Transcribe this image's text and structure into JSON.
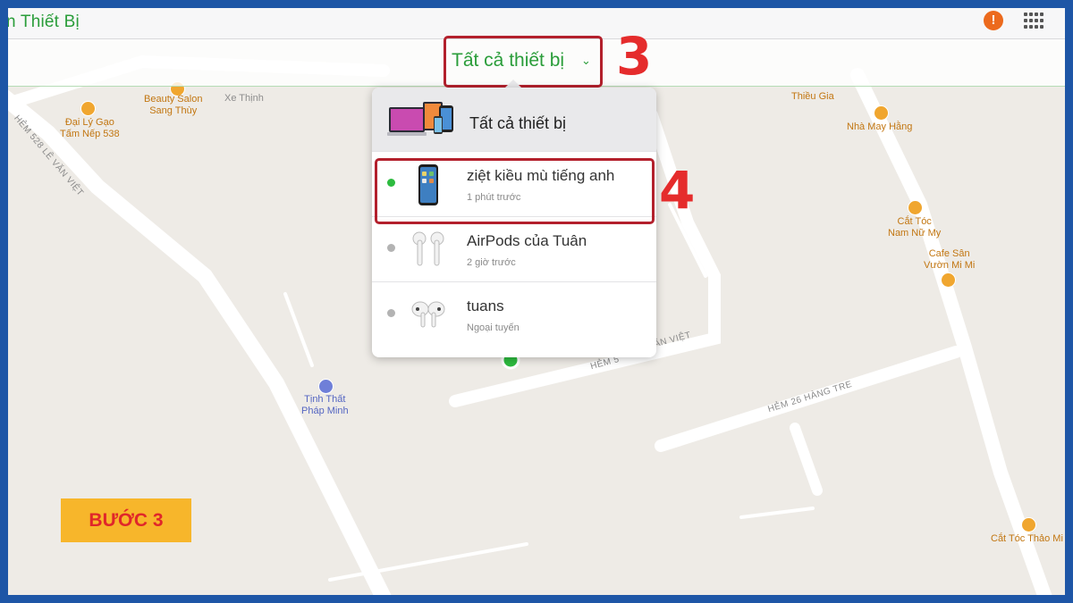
{
  "app": {
    "title": "n Thiết Bị"
  },
  "selector": {
    "label": "Tất cả thiết bị"
  },
  "steps": {
    "three": "3",
    "four": "4",
    "badge": "BƯỚC 3"
  },
  "dropdown": {
    "all_label": "Tất cả thiết bị",
    "devices": [
      {
        "name": "ziệt kiều mù tiếng anh",
        "status": "1 phút trước",
        "online": true
      },
      {
        "name": "AirPods của Tuân",
        "status": "2 giờ trước",
        "online": false
      },
      {
        "name": "tuans",
        "status": "Ngoại tuyến",
        "online": false
      }
    ]
  },
  "map": {
    "pois": [
      {
        "line1": "Đại Lý Gạo",
        "line2": "Tấm Nếp 538"
      },
      {
        "line1": "Beauty Salon",
        "line2": "Sang Thùy"
      },
      {
        "line1": "Xe Thịnh",
        "line2": ""
      },
      {
        "line1": "Thiều Gia",
        "line2": ""
      },
      {
        "line1": "Nhà May Hằng",
        "line2": ""
      },
      {
        "line1": "Cắt Tóc",
        "line2": "Nam Nữ My"
      },
      {
        "line1": "Cafe Sân",
        "line2": "Vườn Mi Mi"
      },
      {
        "line1": "Tịnh Thất",
        "line2": "Pháp Minh"
      },
      {
        "line1": "Cắt Tóc Thảo Mi",
        "line2": ""
      }
    ],
    "streets": {
      "le_van_viet_528": "HẺM 528 LÊ VĂN VIỆT",
      "van_viet": "ĂN VIỆT",
      "hem_prefix": "HẺM 5",
      "hang_tre": "HẺM 26 HÀNG TRE"
    }
  },
  "colors": {
    "accent_green": "#2a9d3a",
    "annotation_red": "#e52c2c",
    "badge_yellow": "#f7b62b",
    "alert_orange": "#ec6a1d"
  },
  "icons": [
    "alert-icon",
    "apps-grid-icon",
    "chevron-down-icon",
    "device-bundle-icon",
    "iphone-icon",
    "airpods-icon",
    "airpods-pro-icon"
  ]
}
